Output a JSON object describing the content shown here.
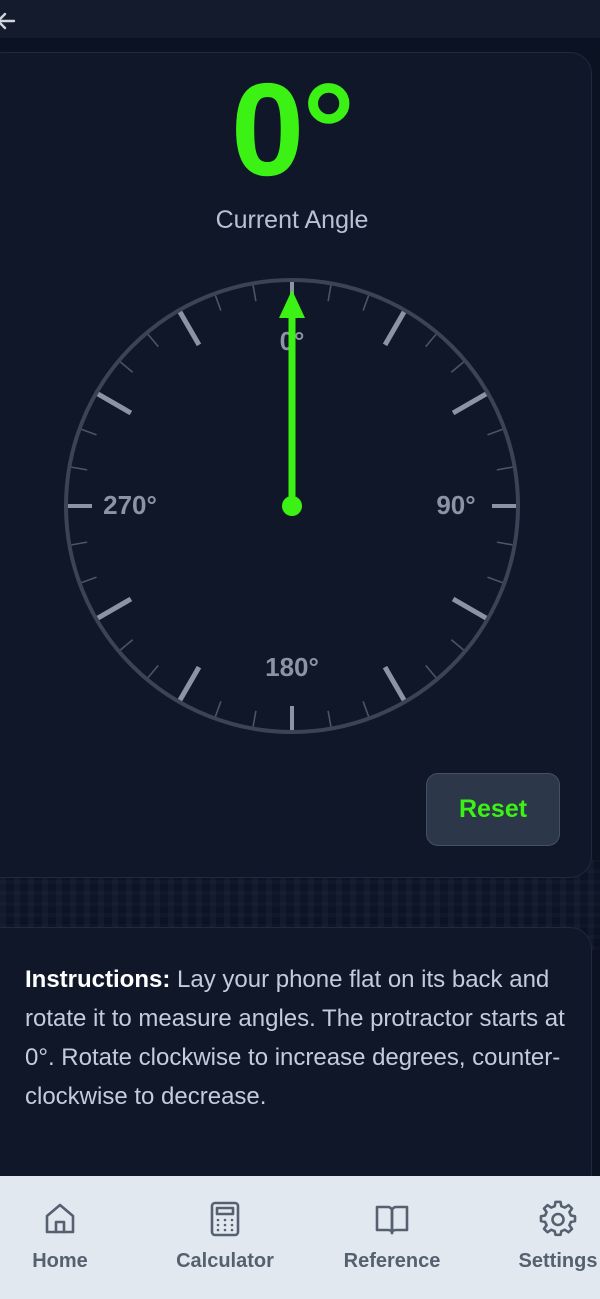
{
  "angle": {
    "value": "0°",
    "label": "Current Angle",
    "degrees": 0,
    "needle_color": "#3cf214"
  },
  "dial": {
    "labels": {
      "top": "0°",
      "right": "90°",
      "bottom": "180°",
      "left": "270°"
    },
    "tick_color": "#4b5566"
  },
  "reset_label": "Reset",
  "instructions": {
    "heading": "Instructions:",
    "body": " Lay your phone flat on its back and rotate it to measure angles. The protractor starts at 0°. Rotate clockwise to increase degrees, counter-clockwise to decrease."
  },
  "nav": {
    "items": [
      {
        "label": "Home",
        "icon": "home-icon"
      },
      {
        "label": "Calculator",
        "icon": "calculator-icon"
      },
      {
        "label": "Reference",
        "icon": "book-icon"
      },
      {
        "label": "Settings",
        "icon": "gear-icon"
      }
    ]
  },
  "colors": {
    "accent": "#3cf214",
    "background": "#0b1222",
    "card": "#0f1729",
    "nav_background": "#e2e8ef"
  }
}
